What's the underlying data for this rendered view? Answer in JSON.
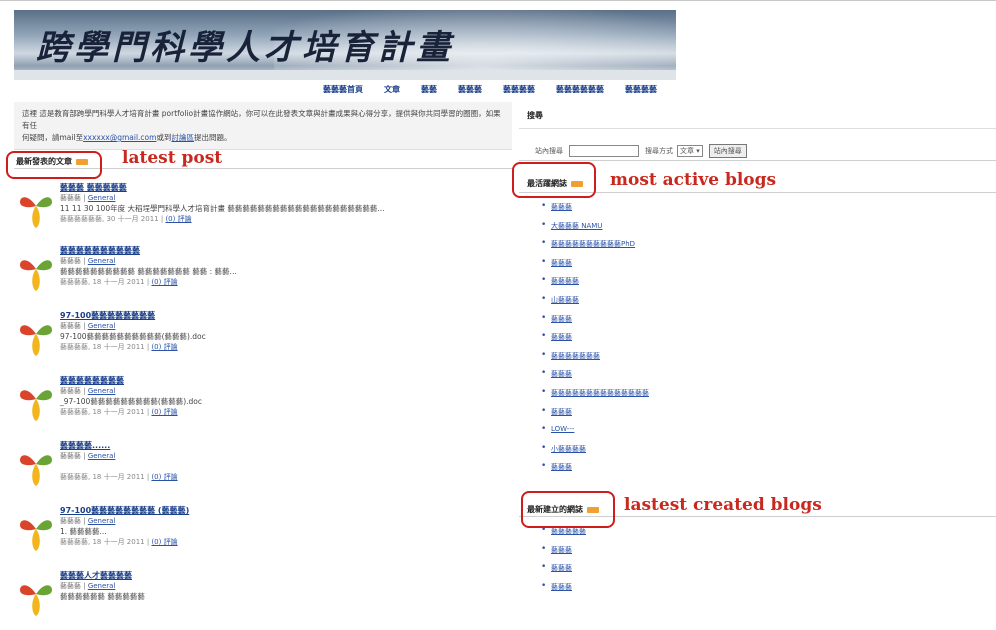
{
  "banner": {
    "title": "跨學門科學人才培育計畫"
  },
  "nav": [
    "藝藝藝首頁",
    "文章",
    "藝藝",
    "藝藝藝",
    "藝藝藝藝",
    "藝藝藝藝藝藝",
    "藝藝藝藝"
  ],
  "intro": {
    "line1": "這裡 這是教育部跨學門科學人才培育計畫 portfolio計畫協作網站，你可以在此發表文章與計畫成果與心得分享，提供與你共同學習的圈圈，如果有任",
    "line2": "何疑問，請mail至",
    "email": "xxxxxx@gmail.com",
    "line3": "或到",
    "link2": "討論區",
    "line4": "提出問題。"
  },
  "latest_post": {
    "heading": "最新發表的文章",
    "posts": [
      {
        "title": "藝藝藝  藝藝藝藝藝",
        "author": "藝藝藝",
        "category": "General",
        "excerpt": "11 11 30 100年度 大稻埕學門科學人才培育計畫 藝藝藝藝藝藝藝藝藝藝藝藝藝藝藝藝藝藝藝藝...",
        "date": "藝藝藝藝藝藝, 30 十一月 2011",
        "comments": "(0) 評論"
      },
      {
        "title": "藝藝藝藝藝藝藝藝藝藝",
        "author": "藝藝藝",
        "category": "General",
        "excerpt": "藝藝藝藝藝藝藝藝藝藝  藝藝藝藝藝藝藝 藝藝 : 藝藝...",
        "date": "藝藝藝藝, 18 十一月 2011",
        "comments": "(0) 評論"
      },
      {
        "title": "97-100藝藝藝藝藝藝藝藝",
        "author": "藝藝藝",
        "category": "General",
        "excerpt": "97-100藝藝藝藝藝藝藝藝藝藝(藝藝藝).doc",
        "date": "藝藝藝藝, 18 十一月 2011",
        "comments": "(0) 評論"
      },
      {
        "title": "藝藝藝藝藝藝藝藝",
        "author": "藝藝藝",
        "category": "General",
        "excerpt": "_97-100藝藝藝藝藝藝藝藝藝(藝藝藝).doc",
        "date": "藝藝藝藝, 18 十一月 2011",
        "comments": "(0) 評論"
      },
      {
        "title": "藝藝藝藝......",
        "author": "藝藝藝",
        "category": "General",
        "excerpt": "",
        "date": "藝藝藝藝, 18 十一月 2011",
        "comments": "(0) 評論"
      },
      {
        "title": "97-100藝藝藝藝藝藝藝藝 (藝藝藝)",
        "author": "藝藝藝",
        "category": "General",
        "excerpt": "1. 藝藝藝藝...",
        "date": "藝藝藝藝, 18 十一月 2011",
        "comments": "(0) 評論"
      },
      {
        "title": "藝藝藝人才藝藝藝藝",
        "author": "藝藝藝",
        "category": "General",
        "excerpt": "藝藝藝藝藝藝  藝藝藝藝藝",
        "date": "",
        "comments": ""
      }
    ]
  },
  "search": {
    "heading": "搜尋",
    "label1": "站內搜尋",
    "label2": "搜尋方式",
    "select_value": "文章",
    "button": "站內搜尋"
  },
  "active_blogs": {
    "heading": "最活躍網誌",
    "items": [
      "藝藝藝",
      "大藝藝藝 NAMU",
      "藝藝藝藝藝藝藝藝藝藝PhD",
      "藝藝藝",
      "藝藝藝藝",
      "山藝藝藝",
      "藝藝藝",
      "藝藝藝",
      "藝藝藝藝藝藝藝",
      "藝藝藝",
      "藝藝藝藝藝藝藝藝藝藝藝藝藝藝",
      "藝藝藝",
      "LOW---",
      "小藝藝藝藝",
      "藝藝藝"
    ]
  },
  "new_blogs": {
    "heading": "最新建立的網誌",
    "items": [
      "藝藝藝藝藝",
      "藝藝藝",
      "藝藝藝",
      "藝藝藝"
    ]
  },
  "annotations": {
    "latest_post": "latest post",
    "most_active": "most active blogs",
    "latest_created": "lastest created blogs"
  }
}
